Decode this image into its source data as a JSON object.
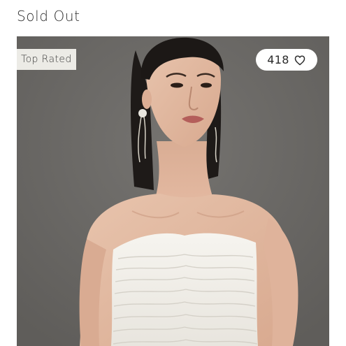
{
  "status": {
    "label": "Sold Out"
  },
  "product": {
    "badge": "Top Rated",
    "likes": "418",
    "image_icon": "model-photo",
    "like_icon": "heart-outline-icon"
  },
  "colors": {
    "background": "#ffffff",
    "photo_backdrop": "#6d6b67",
    "badge_bg": "#ecebe6",
    "text": "#2a2a2a"
  }
}
